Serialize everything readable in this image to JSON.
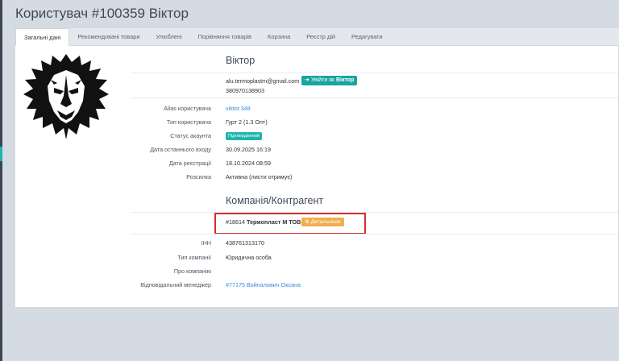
{
  "page": {
    "title": "Користувач #100359 Віктор"
  },
  "tabs": [
    {
      "label": "Загальні дані",
      "active": true
    },
    {
      "label": "Рекомендовані товари"
    },
    {
      "label": "Улюблені"
    },
    {
      "label": "Порівняння товарів"
    },
    {
      "label": "Корзина"
    },
    {
      "label": "Реєстр дій"
    },
    {
      "label": "Редагувати"
    }
  ],
  "user": {
    "name": "Віктор",
    "email": "alu.termoplastm@gmail.com",
    "login_button": {
      "prefix": "Увійти як",
      "name": "Віктор",
      "icon": "sign-in-icon"
    },
    "phone": "380970138903",
    "fields": {
      "alias": {
        "label": "Alias користувача",
        "value": "viktor.348"
      },
      "type": {
        "label": "Тип користувача",
        "value": "Гурт 2 (1.3 Опт)"
      },
      "status": {
        "label": "Статус акаунта",
        "value": "Підтверджений"
      },
      "last_login": {
        "label": "Дата останнього входу",
        "value": "30.09.2025 16:19"
      },
      "registered": {
        "label": "Дата реєстрації",
        "value": "18.10.2024 08:59"
      },
      "newsletter": {
        "label": "Розсилка",
        "value": "Активна (листи отримує)"
      }
    }
  },
  "company": {
    "title": "Компанія/Контрагент",
    "id": "#18614",
    "name": "Термопласт М ТОВ",
    "details_button": {
      "label": "Детальніше",
      "icon": "plus-circle-icon"
    },
    "fields": {
      "inn": {
        "label": "ІНН",
        "value": "438761313170"
      },
      "type": {
        "label": "Тип компанії",
        "value": "Юридична особа"
      },
      "about": {
        "label": "Про компанію",
        "value": ""
      },
      "manager": {
        "label": "Відповідальний менеджер",
        "value": "#77175 Войналович Оксана"
      }
    }
  },
  "colors": {
    "accent": "#1fb5ad",
    "warning": "#f0ad4e",
    "highlight": "#d32f2f",
    "link": "#3b8ad8"
  }
}
